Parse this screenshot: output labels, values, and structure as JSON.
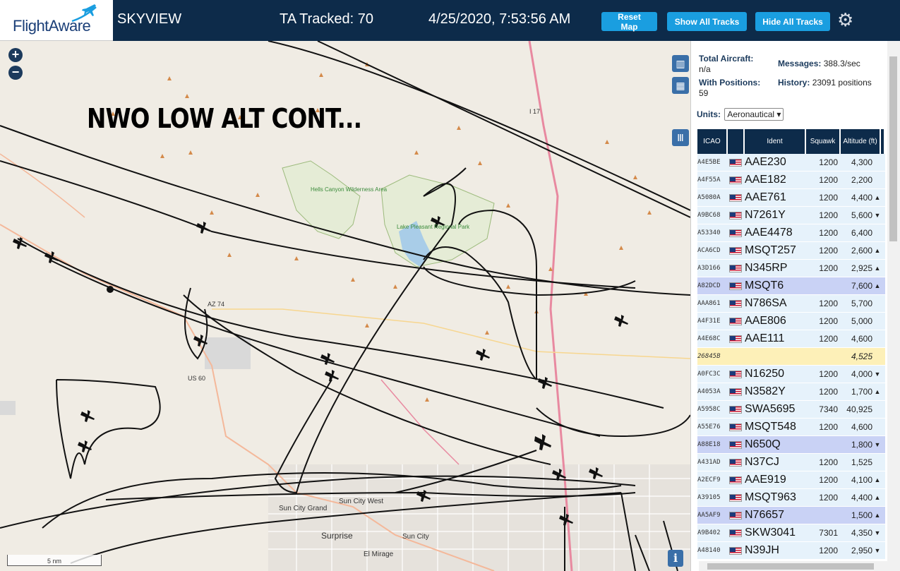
{
  "header": {
    "logo_text": "FlightAware",
    "site_name": "SKYVIEW",
    "tracked": "TA Tracked: 70",
    "timestamp": "4/25/2020, 7:53:56 AM",
    "reset_map": "Reset Map",
    "show_all": "Show All Tracks",
    "hide_all": "Hide All Tracks",
    "settings_icon": "gear-icon"
  },
  "map": {
    "zoom_in": "+",
    "zoom_out": "−",
    "label": "NWO LOW ALT CONT...",
    "scale": "5 nm",
    "info": "i",
    "place_labels": {
      "hells_canyon": "Hells Canyon Wilderness Area",
      "lake_pleasant": "Lake Pleasant Regional Park",
      "sun_city_grand": "Sun City Grand",
      "sun_city_west": "Sun City West",
      "surprise": "Surprise",
      "sun_city": "Sun City",
      "el_mirage": "El Mirage",
      "az74": "AZ 74",
      "us60": "US 60",
      "i17": "I 17"
    }
  },
  "sidebar": {
    "total_aircraft_label": "Total Aircraft:",
    "total_aircraft_value": "n/a",
    "messages_label": "Messages:",
    "messages_value": "388.3/sec",
    "with_positions_label": "With Positions:",
    "with_positions_value": "59",
    "history_label": "History:",
    "history_value": "23091 positions",
    "units_label": "Units:",
    "units_value": "Aeronautical",
    "columns": {
      "icao": "ICAO",
      "ident": "Ident",
      "squawk": "Squawk",
      "altitude": "Altitude (ft)"
    },
    "rows": [
      {
        "icao": "A4E5BE",
        "ident": "AAE230",
        "squawk": "1200",
        "altitude": "4,300",
        "trend": "",
        "state": ""
      },
      {
        "icao": "A4F55A",
        "ident": "AAE182",
        "squawk": "1200",
        "altitude": "2,200",
        "trend": "",
        "state": ""
      },
      {
        "icao": "A5080A",
        "ident": "AAE761",
        "squawk": "1200",
        "altitude": "4,400",
        "trend": "▲",
        "state": ""
      },
      {
        "icao": "A9BC68",
        "ident": "N7261Y",
        "squawk": "1200",
        "altitude": "5,600",
        "trend": "▼",
        "state": ""
      },
      {
        "icao": "A53340",
        "ident": "AAE4478",
        "squawk": "1200",
        "altitude": "6,400",
        "trend": "",
        "state": ""
      },
      {
        "icao": "ACA6CD",
        "ident": "MSQT257",
        "squawk": "1200",
        "altitude": "2,600",
        "trend": "▲",
        "state": ""
      },
      {
        "icao": "A3D166",
        "ident": "N345RP",
        "squawk": "1200",
        "altitude": "2,925",
        "trend": "▲",
        "state": ""
      },
      {
        "icao": "A82DCD",
        "ident": "MSQT6",
        "squawk": "",
        "altitude": "7,600",
        "trend": "▲",
        "state": "sel"
      },
      {
        "icao": "AAA861",
        "ident": "N786SA",
        "squawk": "1200",
        "altitude": "5,700",
        "trend": "",
        "state": ""
      },
      {
        "icao": "A4F31E",
        "ident": "AAE806",
        "squawk": "1200",
        "altitude": "5,000",
        "trend": "",
        "state": ""
      },
      {
        "icao": "A4E68C",
        "ident": "AAE111",
        "squawk": "1200",
        "altitude": "4,600",
        "trend": "",
        "state": ""
      },
      {
        "icao": "26845B",
        "ident": "",
        "squawk": "",
        "altitude": "4,525",
        "trend": "",
        "state": "nopos"
      },
      {
        "icao": "A0FC3C",
        "ident": "N16250",
        "squawk": "1200",
        "altitude": "4,000",
        "trend": "▼",
        "state": ""
      },
      {
        "icao": "A4053A",
        "ident": "N3582Y",
        "squawk": "1200",
        "altitude": "1,700",
        "trend": "▲",
        "state": ""
      },
      {
        "icao": "A5958C",
        "ident": "SWA5695",
        "squawk": "7340",
        "altitude": "40,925",
        "trend": "",
        "state": ""
      },
      {
        "icao": "A55E76",
        "ident": "MSQT548",
        "squawk": "1200",
        "altitude": "4,600",
        "trend": "",
        "state": ""
      },
      {
        "icao": "A88E18",
        "ident": "N650Q",
        "squawk": "",
        "altitude": "1,800",
        "trend": "▼",
        "state": "sel"
      },
      {
        "icao": "A431AD",
        "ident": "N37CJ",
        "squawk": "1200",
        "altitude": "1,525",
        "trend": "",
        "state": ""
      },
      {
        "icao": "A2ECF9",
        "ident": "AAE919",
        "squawk": "1200",
        "altitude": "4,100",
        "trend": "▲",
        "state": ""
      },
      {
        "icao": "A39105",
        "ident": "MSQT963",
        "squawk": "1200",
        "altitude": "4,400",
        "trend": "▲",
        "state": ""
      },
      {
        "icao": "AA5AF9",
        "ident": "N76657",
        "squawk": "",
        "altitude": "1,500",
        "trend": "▲",
        "state": "sel"
      },
      {
        "icao": "A9B402",
        "ident": "SKW3041",
        "squawk": "7301",
        "altitude": "4,350",
        "trend": "▼",
        "state": ""
      },
      {
        "icao": "A48140",
        "ident": "N39JH",
        "squawk": "1200",
        "altitude": "2,950",
        "trend": "▼",
        "state": ""
      }
    ]
  },
  "colors": {
    "header_bg": "#0d2b4a",
    "button": "#1a9ee0",
    "row": "#e6f2fb",
    "row_selected": "#c9d2f5",
    "row_nopos": "#fdf0b8"
  }
}
